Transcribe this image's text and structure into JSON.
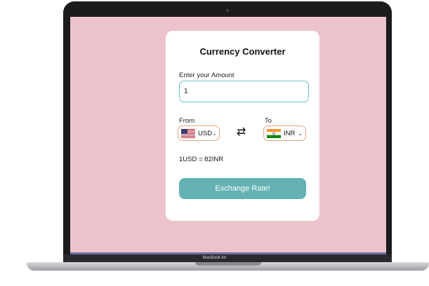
{
  "device": {
    "brand_label": "MacBook Air"
  },
  "colors": {
    "background": "#edc3cb",
    "accent": "#63b1b2",
    "input_border": "#6ec3c3",
    "select_border": "#e6a57a"
  },
  "converter": {
    "title": "Currency Converter",
    "amount_label": "Enter your Amount",
    "amount_value": "1",
    "from_label": "From",
    "to_label": "To",
    "from_currency": "USD",
    "to_currency": "INR",
    "from_flag_icon": "us-flag-icon",
    "to_flag_icon": "india-flag-icon",
    "swap_icon": "swap-arrows-icon",
    "rate_text": "1USD = 82INR",
    "button_label": "Exchange Rate!"
  }
}
